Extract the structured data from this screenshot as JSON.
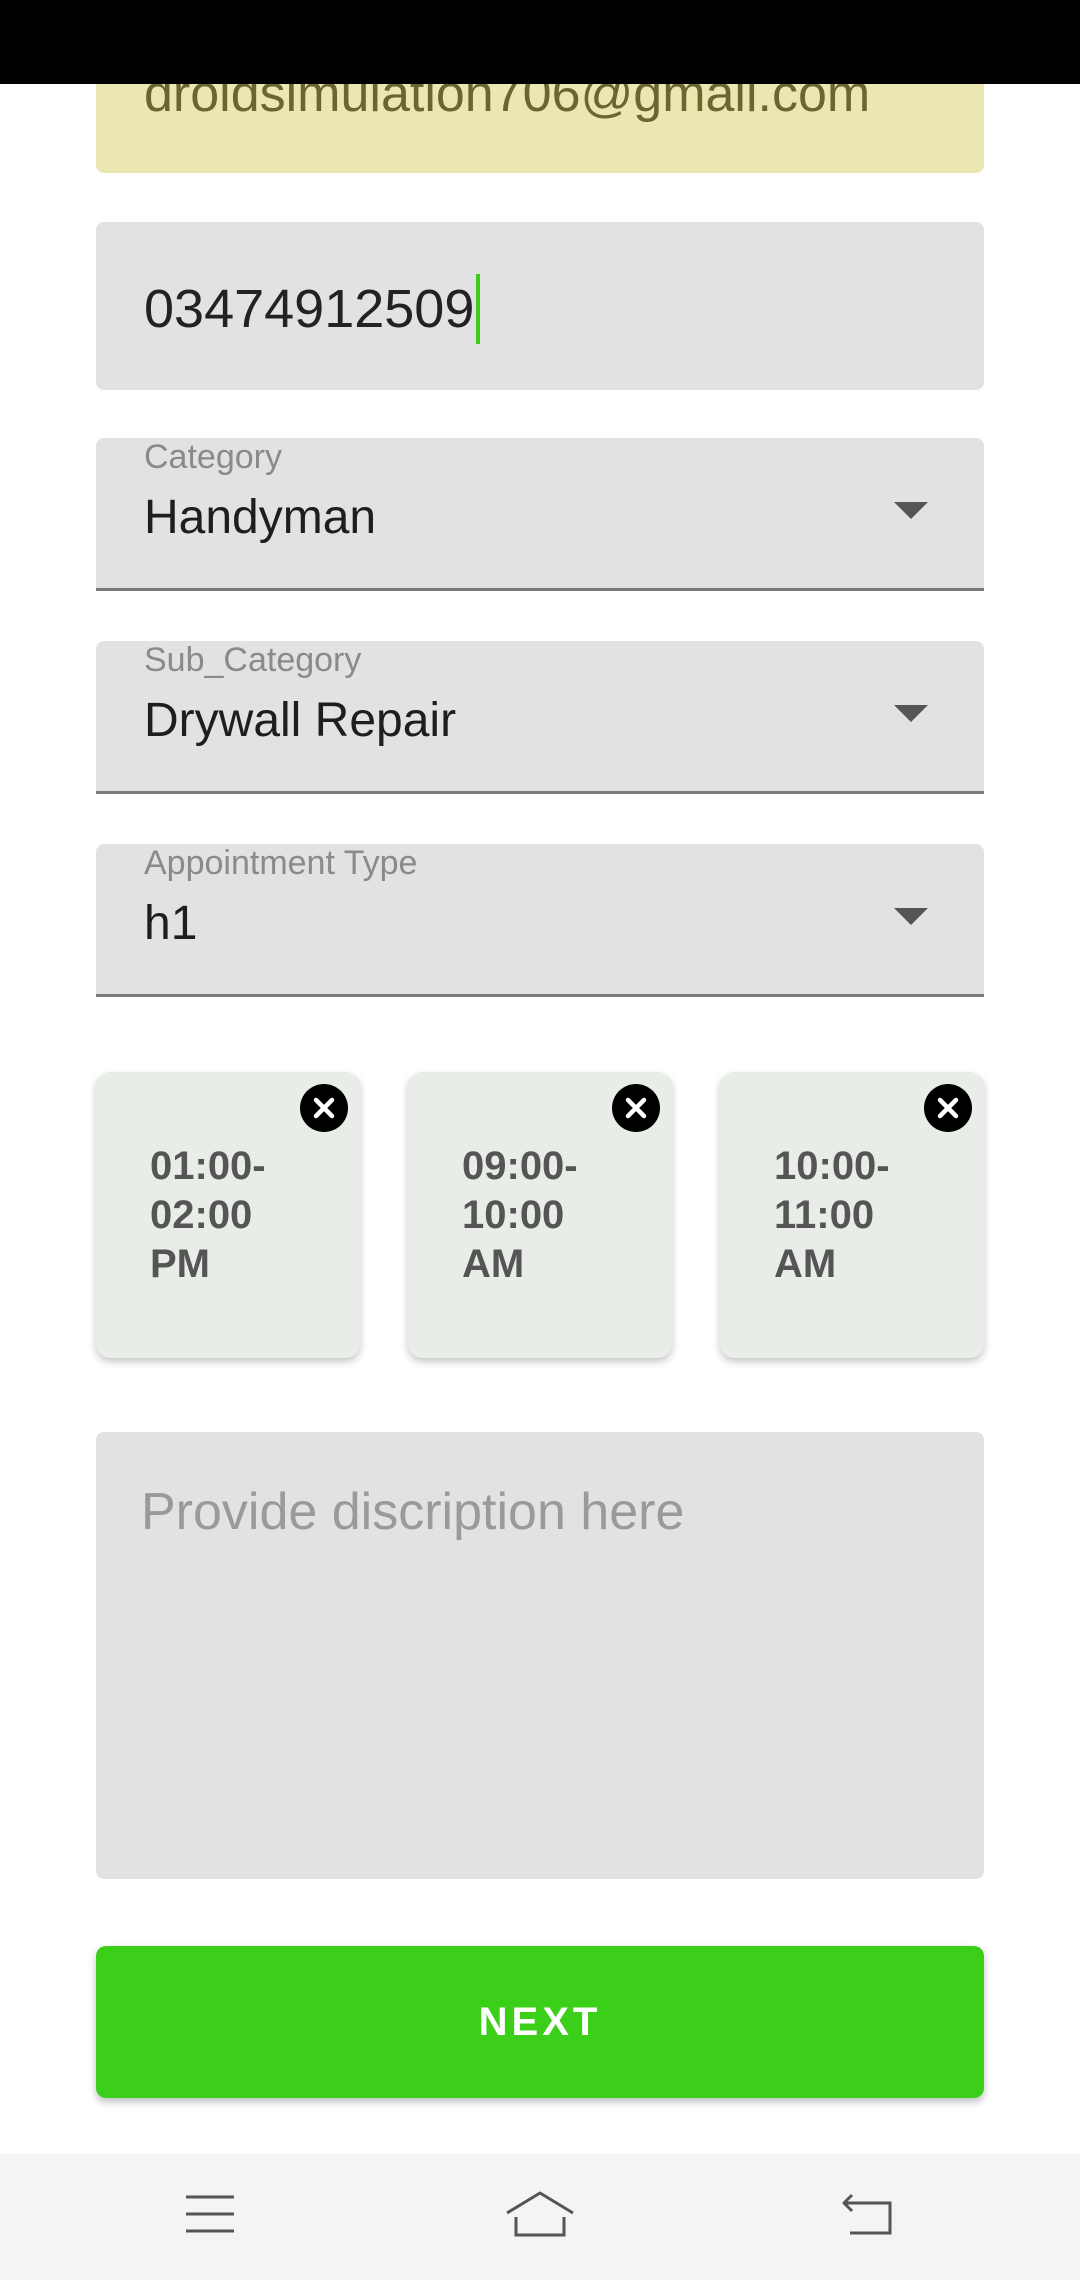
{
  "form": {
    "email_value": "droidsimulation706@gmail.com",
    "phone_value": "03474912509",
    "category": {
      "label": "Category",
      "value": "Handyman"
    },
    "sub_category": {
      "label": "Sub_Category",
      "value": "Drywall Repair"
    },
    "appointment_type": {
      "label": "Appointment Type",
      "value": "h1"
    },
    "time_slots": [
      {
        "text": "01:00-02:00 PM"
      },
      {
        "text": "09:00-10:00 AM"
      },
      {
        "text": "10:00-11:00 AM"
      }
    ],
    "description_placeholder": "Provide discription here",
    "next_label": "NEXT"
  },
  "nav": {
    "icons": [
      "menu-icon",
      "home-icon",
      "back-icon"
    ]
  },
  "colors": {
    "accent": "#3ccf1a",
    "email_bg": "#ebe7b0",
    "field_bg": "#e2e2e2",
    "chip_bg": "#e8ede8"
  }
}
